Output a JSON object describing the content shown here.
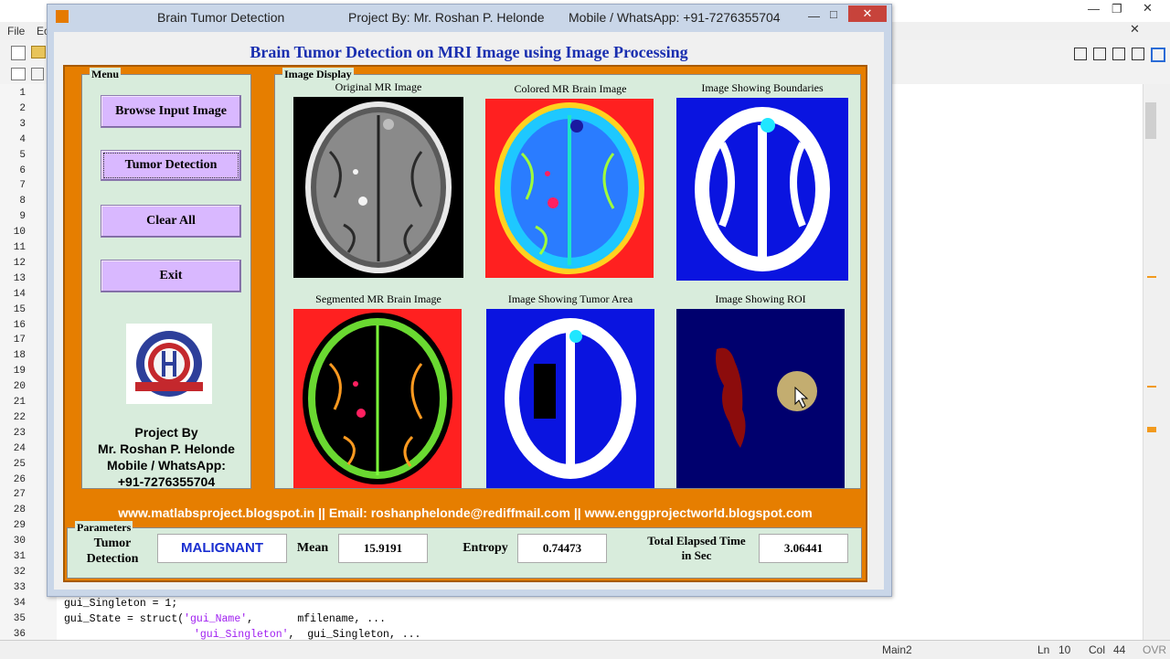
{
  "editor": {
    "menu_file": "File",
    "menu_edit_partial": "Ec",
    "line_numbers": [
      "1",
      "2",
      "3",
      "4",
      "5",
      "6",
      "7",
      "8",
      "9",
      "10",
      "11",
      "12",
      "13",
      "14",
      "15",
      "16",
      "17",
      "18",
      "19",
      "20",
      "21",
      "22",
      "23",
      "24",
      "25",
      "26",
      "27",
      "28",
      "29",
      "30",
      "31",
      "32",
      "33",
      "34",
      "35",
      "36"
    ],
    "code_line_34": "gui_Singleton = 1;",
    "code_line_35_a": "gui_State = struct(",
    "code_line_35_str1": "'gui_Name'",
    "code_line_35_b": ",       mfilename, ...",
    "code_line_36_str": "'gui_Singleton'",
    "code_line_36_b": ",  gui_Singleton, ...",
    "status_func": "Main2",
    "status_ln_label": "Ln",
    "status_ln": "10",
    "status_col_label": "Col",
    "status_col": "44",
    "status_ovr": "OVR"
  },
  "gui": {
    "window_title": "Brain Tumor Detection",
    "window_project": "Project By: Mr. Roshan P. Helonde",
    "window_mobile": "Mobile / WhatsApp: +91-7276355704",
    "header": "Brain Tumor Detection on MRI Image using Image Processing",
    "menu_label": "Menu",
    "buttons": {
      "browse": "Browse Input Image",
      "detect": "Tumor Detection",
      "clear": "Clear All",
      "exit": "Exit"
    },
    "credits": {
      "l1": "Project By",
      "l2": "Mr. Roshan P. Helonde",
      "l3": "Mobile / WhatsApp:",
      "l4": "+91-7276355704"
    },
    "display_label": "Image Display",
    "captions": {
      "original": "Original MR Image",
      "colored": "Colored MR Brain Image",
      "boundaries": "Image Showing Boundaries",
      "segmented": "Segmented MR Brain Image",
      "tumor_area": "Image Showing Tumor Area",
      "roi": "Image Showing ROI"
    },
    "footer": "www.matlabsproject.blogspot.in ||  Email: roshanphelonde@rediffmail.com  ||  www.enggprojectworld.blogspot.com",
    "parameters": {
      "label": "Parameters",
      "detection_label_1": "Tumor",
      "detection_label_2": "Detection",
      "detection_value": "MALIGNANT",
      "mean_label": "Mean",
      "mean_value": "15.9191",
      "entropy_label": "Entropy",
      "entropy_value": "0.74473",
      "time_label_1": "Total Elapsed Time",
      "time_label_2": "in Sec",
      "time_value": "3.06441"
    }
  },
  "colors": {
    "accent_orange": "#e67e00",
    "panel_green": "#d8ecdc",
    "button_purple": "#d9b8ff",
    "header_blue": "#1a2fb0",
    "malignant_blue": "#1a2fd0"
  }
}
